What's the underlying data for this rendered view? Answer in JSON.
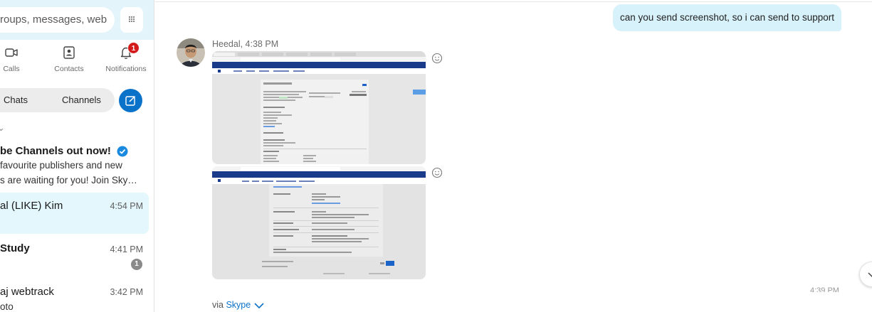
{
  "search": {
    "text": "roups, messages, web"
  },
  "nav": {
    "calls": "Calls",
    "contacts": "Contacts",
    "notifications": "Notifications",
    "notifications_badge": "1"
  },
  "toggle": {
    "chats": "Chats",
    "channels": "Channels"
  },
  "chats": [
    {
      "name": "be Channels out now!",
      "line1": "favourite publishers and new",
      "line2": "s are waiting for you! Join Sky…",
      "verified": true
    },
    {
      "name": "al (LIKE) Kim",
      "time": "4:54 PM",
      "selected": true
    },
    {
      "name": "Study",
      "time": "4:41 PM",
      "unread": "1"
    },
    {
      "name": "aj webtrack",
      "time": "3:42 PM",
      "line1": "oto"
    }
  ],
  "conversation": {
    "outgoing_text": "can you send screenshot, so i can send to support",
    "sender_line": "Heedal, 4:38 PM",
    "ghost_time": "4:39 PM",
    "via_prefix": "via ",
    "via_link": "Skype"
  },
  "icons": {
    "search": "search-icon",
    "dialpad": "dialpad-icon",
    "calls": "video-camera-icon",
    "contacts": "contact-card-icon",
    "notifications": "bell-icon",
    "compose": "compose-icon",
    "verified": "verified-check-icon",
    "react": "smiley-icon",
    "scroll": "chevron-down-icon"
  },
  "colors": {
    "accent": "#0b72c9",
    "search_band": "#e3f4fb",
    "outgoing_bubble": "#d8f2fb",
    "selected_chat": "#e3f7fd",
    "badge_red": "#d31b1b"
  }
}
